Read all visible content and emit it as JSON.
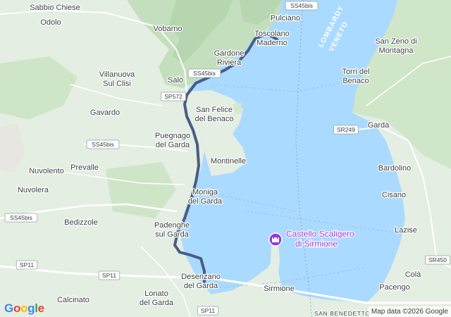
{
  "map": {
    "places": [
      {
        "id": "sabbio-chiese",
        "text": "Sabbio Chiese"
      },
      {
        "id": "odolo",
        "text": "Odolo"
      },
      {
        "id": "vobarno",
        "text": "Vobarno"
      },
      {
        "id": "pulciano",
        "text": "Pulciano"
      },
      {
        "id": "toscolano-maderno",
        "text": "Toscolano\nMaderno"
      },
      {
        "id": "gardone-riviera",
        "text": "Gardone\nRiviera"
      },
      {
        "id": "salo",
        "text": "Salò"
      },
      {
        "id": "villanuova",
        "text": "Villanuova\nSul Clisi"
      },
      {
        "id": "gavardo",
        "text": "Gavardo"
      },
      {
        "id": "san-felice",
        "text": "San Felice\ndel Benaco"
      },
      {
        "id": "puegnago",
        "text": "Puegnago\ndel Garda"
      },
      {
        "id": "nuvolento",
        "text": "Nuvolento"
      },
      {
        "id": "prevalle",
        "text": "Prevalle"
      },
      {
        "id": "montinelle",
        "text": "Montinelle"
      },
      {
        "id": "nuvolera",
        "text": "Nuvolera"
      },
      {
        "id": "moniga",
        "text": "Moniga\ndel Garda"
      },
      {
        "id": "bedizzole",
        "text": "Bedizzole"
      },
      {
        "id": "padenghe",
        "text": "Padenghe\nsul Garda"
      },
      {
        "id": "desenzano",
        "text": "Desenzano\ndel Garda"
      },
      {
        "id": "lonato",
        "text": "Lonato\ndel Garda"
      },
      {
        "id": "calcinato",
        "text": "Calcinato"
      },
      {
        "id": "sirmione",
        "text": "Sirmione"
      },
      {
        "id": "san-zeno",
        "text": "San Zeno di\nMontagna"
      },
      {
        "id": "torri",
        "text": "Torri del\nBenaco"
      },
      {
        "id": "garda",
        "text": "Garda"
      },
      {
        "id": "bardolino",
        "text": "Bardolino"
      },
      {
        "id": "cisano",
        "text": "Cisano"
      },
      {
        "id": "lazise",
        "text": "Lazise"
      },
      {
        "id": "cola",
        "text": "Colà"
      },
      {
        "id": "pacengo",
        "text": "Pacengo"
      }
    ],
    "san_benedetto": "SAN BENEDETTO",
    "regions": [
      "LOMBARDY",
      "VENETO"
    ],
    "roads": [
      "SS45bis",
      "SS45bis",
      "SP572",
      "SS45bis",
      "SS45bis",
      "SP11",
      "SP11",
      "SP11",
      "SR249",
      "SR450"
    ],
    "poi": {
      "line1": "Castello Scaligero",
      "line2": "di Sirmione",
      "icon": "castle-icon"
    }
  },
  "branding": {
    "logo_letters": [
      "G",
      "o",
      "o",
      "g",
      "l",
      "e"
    ],
    "attribution": "Map data ©2026 Google"
  },
  "colors": {
    "water": "#aadaff",
    "land": "#e4eee2",
    "forest": "#c9e4c4",
    "mountain": "#b9d6b3",
    "route": "#4b5c85",
    "road": "#ffffff",
    "poi": "#9334e6"
  }
}
